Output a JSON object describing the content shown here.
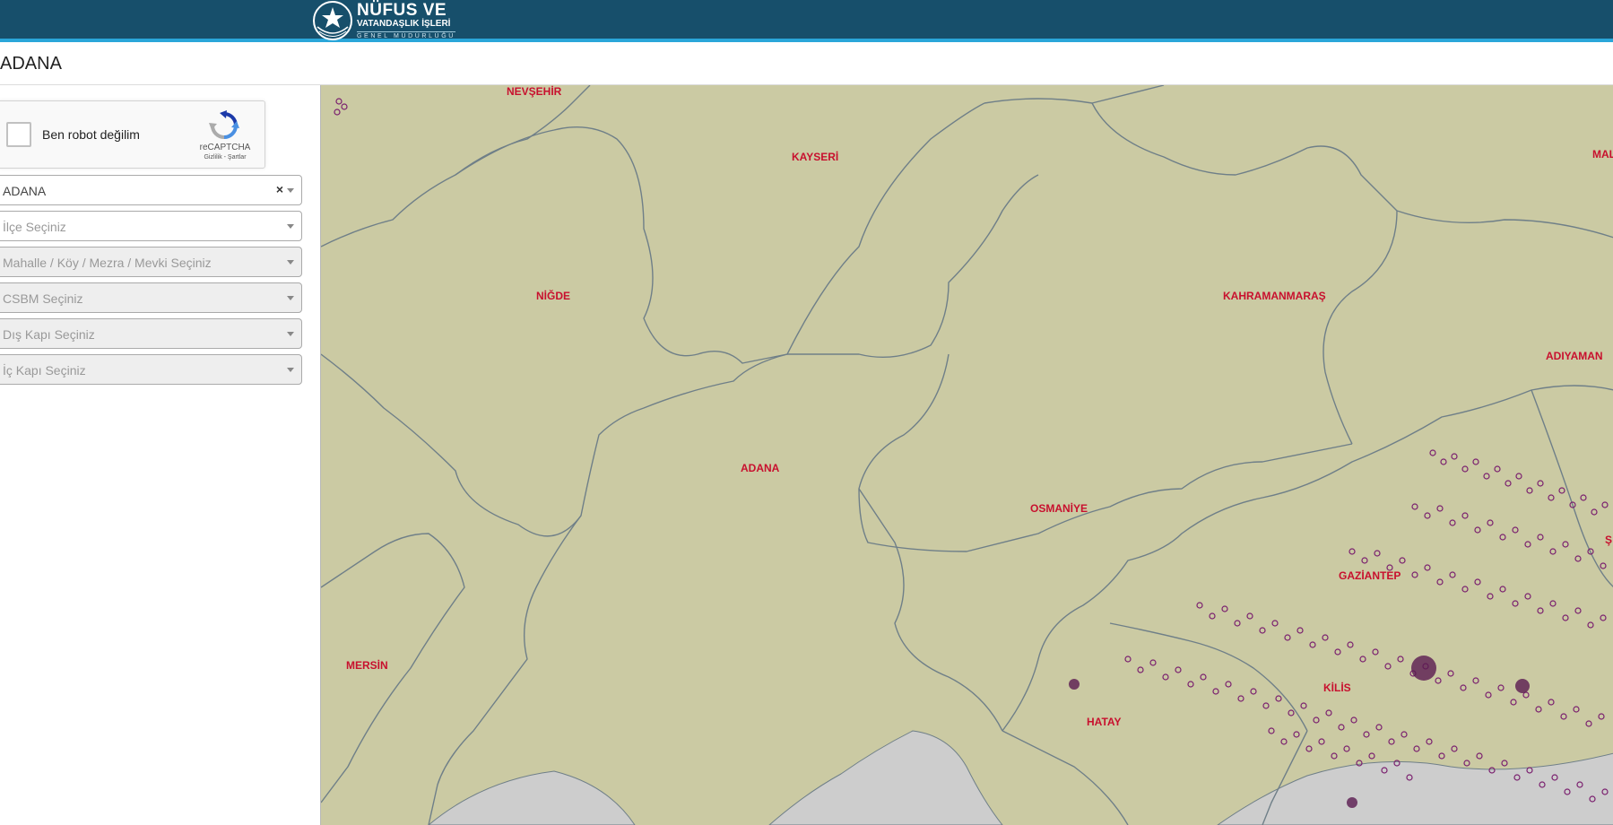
{
  "header": {
    "logo": {
      "line1": "NÜFUS VE",
      "line2": "VATANDAŞLIK İŞLERİ",
      "line3": "GENEL MÜDÜRLÜĞÜ"
    }
  },
  "titlebar": {
    "title": "ADANA"
  },
  "sidebar": {
    "captcha": {
      "label": "Ben robot değilim",
      "brand": "reCAPTCHA",
      "links": "Gizlilik - Şartlar"
    },
    "province_select": {
      "value": "ADANA",
      "clear": "×"
    },
    "district_select": {
      "placeholder": "İlçe Seçiniz"
    },
    "neighborhood_select": {
      "placeholder": "Mahalle / Köy / Mezra / Mevki Seçiniz"
    },
    "csbm_select": {
      "placeholder": "CSBM Seçiniz"
    },
    "outer_door_select": {
      "placeholder": "Dış Kapı Seçiniz"
    },
    "inner_door_select": {
      "placeholder": "İç Kapı Seçiniz"
    }
  },
  "map": {
    "colors": {
      "land": "#cbcaa3",
      "sea": "#cdcdcd",
      "border": "#6f7f88",
      "label": "#c8102e",
      "point": "#7a1f6e"
    },
    "provinces": {
      "nevsehir": "NEVŞEHİR",
      "kayseri": "KAYSERİ",
      "malatya": "MAL",
      "nigde": "NİĞDE",
      "kahramanmaras": "KAHRAMANMARAŞ",
      "adiyaman": "ADIYAMAN",
      "adana": "ADANA",
      "osmaniye": "OSMANİYE",
      "gaziantep": "GAZİANTEP",
      "sanliurfa": "Ş",
      "mersin": "MERSİN",
      "kilis": "KİLİS",
      "hatay": "HATAY"
    }
  }
}
